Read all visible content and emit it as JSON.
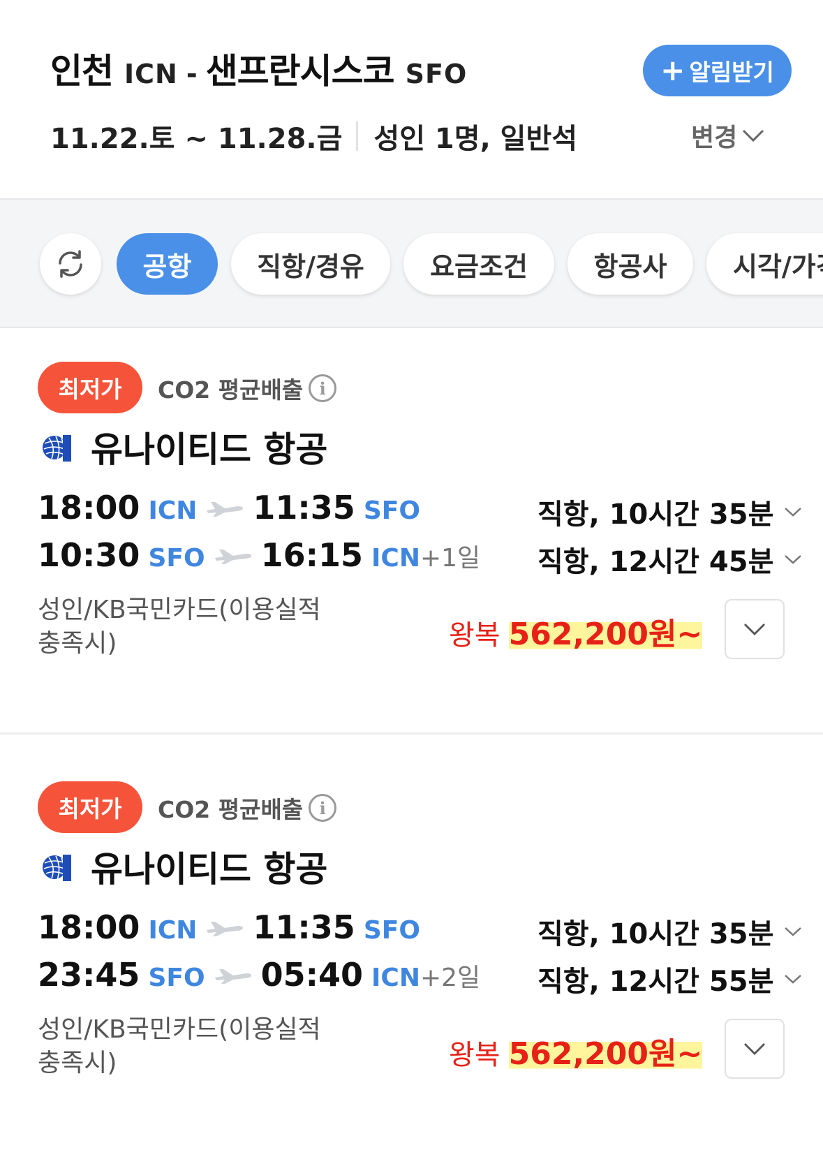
{
  "header": {
    "origin_city": "인천",
    "origin_code": "ICN",
    "dash": "-",
    "dest_city": "샌프란시스코",
    "dest_code": "SFO",
    "alert_plus": "+",
    "alert_label": "알림받기",
    "dates": "11.22.토 ~ 11.28.금",
    "passengers": "성인 1명, 일반석",
    "change_label": "변경"
  },
  "filters": {
    "chips": [
      "공항",
      "직항/경유",
      "요금조건",
      "항공사",
      "시각/가격"
    ],
    "active_index": 0
  },
  "results": [
    {
      "badge": "최저가",
      "co2_label": "CO2 평균배출",
      "airline": "유나이티드 항공",
      "legs": [
        {
          "dep_time": "18:00",
          "dep_code": "ICN",
          "arr_time": "11:35",
          "arr_code": "SFO",
          "plus_day": "",
          "summary": "직항, 10시간 35분"
        },
        {
          "dep_time": "10:30",
          "dep_code": "SFO",
          "arr_time": "16:15",
          "arr_code": "ICN",
          "plus_day": "+1일",
          "summary": "직항, 12시간 45분"
        }
      ],
      "fare_note": "성인/KB국민카드(이용실적 충족시)",
      "price_label": "왕복",
      "price": "562,200원~"
    },
    {
      "badge": "최저가",
      "co2_label": "CO2 평균배출",
      "airline": "유나이티드 항공",
      "legs": [
        {
          "dep_time": "18:00",
          "dep_code": "ICN",
          "arr_time": "11:35",
          "arr_code": "SFO",
          "plus_day": "",
          "summary": "직항, 10시간 35분"
        },
        {
          "dep_time": "23:45",
          "dep_code": "SFO",
          "arr_time": "05:40",
          "arr_code": "ICN",
          "plus_day": "+2일",
          "summary": "직항, 12시간 55분"
        }
      ],
      "fare_note": "성인/KB국민카드(이용실적 충족시)",
      "price_label": "왕복",
      "price": "562,200원~"
    }
  ],
  "colors": {
    "accent": "#4a90e8",
    "badge": "#f5543a",
    "price": "#e62117",
    "airport_code": "#3f86e0",
    "highlight": "#fff59d"
  },
  "icons": {
    "refresh": "refresh-icon",
    "plane": "plane-icon",
    "info": "info-icon",
    "chevron": "chevron-down-icon",
    "airline_logo": "united-globe-icon"
  }
}
